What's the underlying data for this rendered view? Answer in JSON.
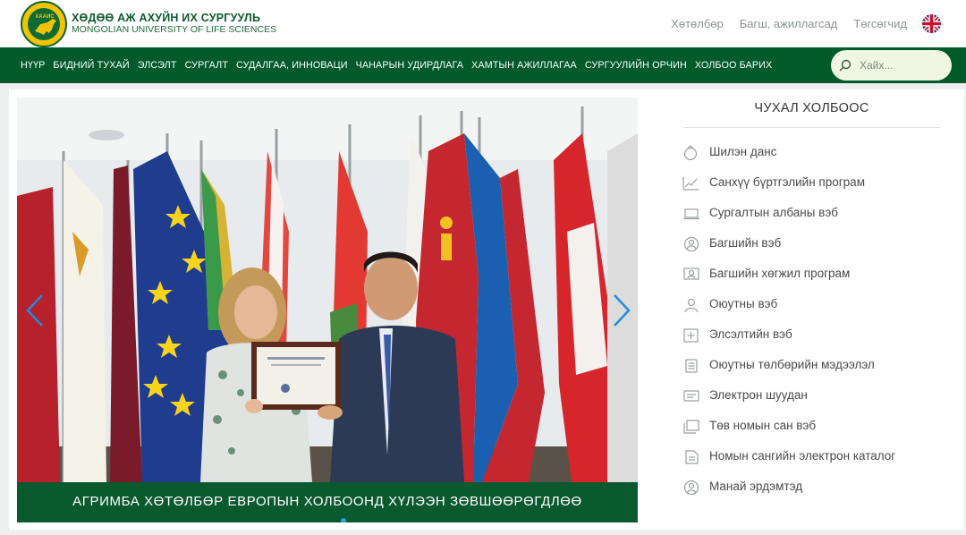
{
  "header": {
    "brand_line1": "ХӨДӨӨ АЖ АХУЙН ИХ СУРГУУЛЬ",
    "brand_line2": "MONGOLIAN UNIVERSITY OF LIFE SCIENCES",
    "logo_text": "ХААИС",
    "top_links": [
      "Хөтөлбөр",
      "Багш, ажиллагсад",
      "Төгсөгчид"
    ]
  },
  "nav": {
    "items": [
      "НҮҮР",
      "БИДНИЙ ТУХАЙ",
      "ЭЛСЭЛТ",
      "СУРГАЛТ",
      "СУДАЛГАА, ИННОВАЦИ",
      "ЧАНАРЫН УДИРДЛАГА",
      "ХАМТЫН АЖИЛЛАГАА",
      "СУРГУУЛИЙН ОРЧИН",
      "ХОЛБОО БАРИХ"
    ]
  },
  "search": {
    "placeholder": "Хайх..."
  },
  "slider": {
    "caption": "АГРИМБА ХӨТӨЛБӨР ЕВРОПЫН ХОЛБООНД ХҮЛЭЭН ЗӨВШӨӨРӨГДЛӨӨ"
  },
  "important_links": {
    "title": "ЧУХАЛ ХОЛБООС",
    "items": [
      {
        "label": "Шилэн данс",
        "icon": "glass-account-icon"
      },
      {
        "label": "Санхүү бүртгэлийн програм",
        "icon": "finance-chart-icon"
      },
      {
        "label": "Сургалтын албаны вэб",
        "icon": "laptop-icon"
      },
      {
        "label": "Багшийн вэб",
        "icon": "teacher-icon"
      },
      {
        "label": "Багшийн хөгжил програм",
        "icon": "teacher-development-icon"
      },
      {
        "label": "Оюутны вэб",
        "icon": "student-icon"
      },
      {
        "label": "Элсэлтийн вэб",
        "icon": "admission-icon"
      },
      {
        "label": "Оюутны төлбөрийн мэдээлэл",
        "icon": "payment-info-icon"
      },
      {
        "label": "Электрон шуудан",
        "icon": "email-icon"
      },
      {
        "label": "Төв номын сан вэб",
        "icon": "library-icon"
      },
      {
        "label": "Номын сангийн электрон каталог",
        "icon": "catalog-icon"
      },
      {
        "label": "Манай эрдэмтэд",
        "icon": "scientists-icon"
      }
    ]
  },
  "colors": {
    "nav_green": "#005a2b",
    "caption_green": "#005a2b",
    "brand_green": "#0d5a2d",
    "accent_blue": "#22a3e2"
  }
}
